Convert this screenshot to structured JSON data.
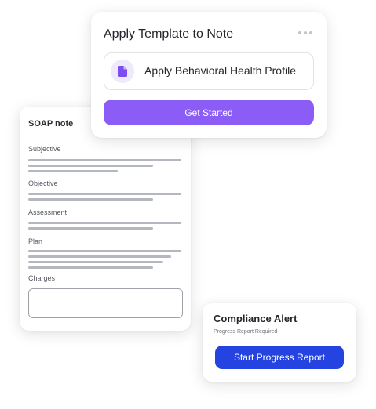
{
  "soap_note": {
    "title": "SOAP note",
    "sections": [
      {
        "label": "Subjective"
      },
      {
        "label": "Objective"
      },
      {
        "label": "Assessment"
      },
      {
        "label": "Plan"
      }
    ],
    "charges_label": "Charges",
    "charges_value": ""
  },
  "apply_template": {
    "title": "Apply Template to Note",
    "more_icon": "more-horizontal-icon",
    "option_icon": "document-icon",
    "option_label": "Apply Behavioral Health Profile",
    "button_label": "Get Started"
  },
  "compliance_alert": {
    "title": "Compliance Alert",
    "subtitle": "Progress Report Required",
    "button_label": "Start Progress Report"
  },
  "colors": {
    "accent_purple": "#8b5cf6",
    "accent_blue": "#2443e0",
    "placeholder_line": "#b4b7bd"
  }
}
